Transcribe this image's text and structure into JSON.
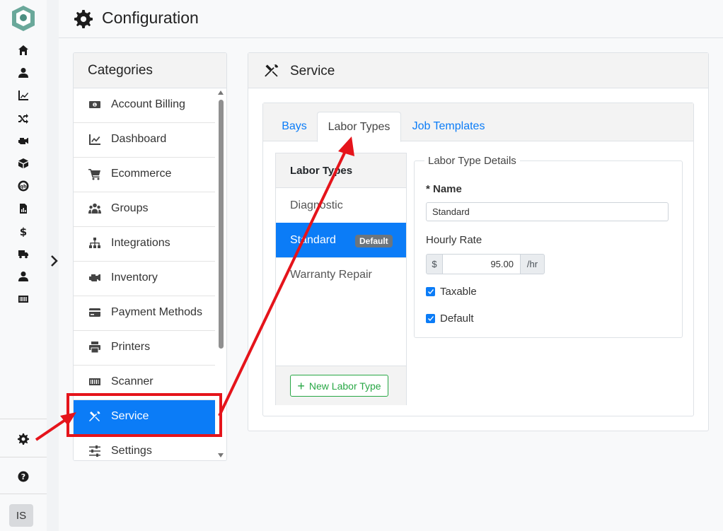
{
  "rail": {
    "icons": [
      "home-icon",
      "user-icon",
      "chart-line-icon",
      "shuffle-icon",
      "engine-icon",
      "box-icon",
      "quickbooks-icon",
      "report-icon",
      "dollar-icon",
      "truck-icon",
      "user-icon",
      "barcode-icon"
    ],
    "bottom_icons": [
      "gear-icon",
      "help-icon"
    ],
    "avatar": "IS"
  },
  "header": {
    "title": "Configuration"
  },
  "categories": {
    "title": "Categories",
    "items": [
      {
        "label": "Account Billing",
        "icon": "money-bill-icon"
      },
      {
        "label": "Dashboard",
        "icon": "chart-line-icon"
      },
      {
        "label": "Ecommerce",
        "icon": "cart-icon"
      },
      {
        "label": "Groups",
        "icon": "users-icon"
      },
      {
        "label": "Integrations",
        "icon": "sitemap-icon"
      },
      {
        "label": "Inventory",
        "icon": "engine-icon"
      },
      {
        "label": "Payment Methods",
        "icon": "credit-card-icon"
      },
      {
        "label": "Printers",
        "icon": "printer-icon"
      },
      {
        "label": "Scanner",
        "icon": "barcode-icon"
      },
      {
        "label": "Service",
        "icon": "tools-icon"
      },
      {
        "label": "Settings",
        "icon": "sliders-icon"
      }
    ],
    "active": "Service"
  },
  "service": {
    "title": "Service",
    "tabs": [
      "Bays",
      "Labor Types",
      "Job Templates"
    ],
    "active_tab": "Labor Types",
    "labor_list": {
      "title": "Labor Types",
      "items": [
        "Diagnostic",
        "Standard",
        "Warranty Repair"
      ],
      "active": "Standard",
      "badge": "Default",
      "new_button": "New Labor Type"
    },
    "details": {
      "legend": "Labor Type Details",
      "name_label": "* Name",
      "name_value": "Standard",
      "rate_label": "Hourly Rate",
      "rate_prefix": "$",
      "rate_value": "95.00",
      "rate_suffix": "/hr",
      "taxable_label": "Taxable",
      "taxable_checked": true,
      "default_label": "Default",
      "default_checked": true
    }
  },
  "colors": {
    "accent": "#0b7cf7",
    "success": "#28a745",
    "annotation": "#e5141b"
  }
}
